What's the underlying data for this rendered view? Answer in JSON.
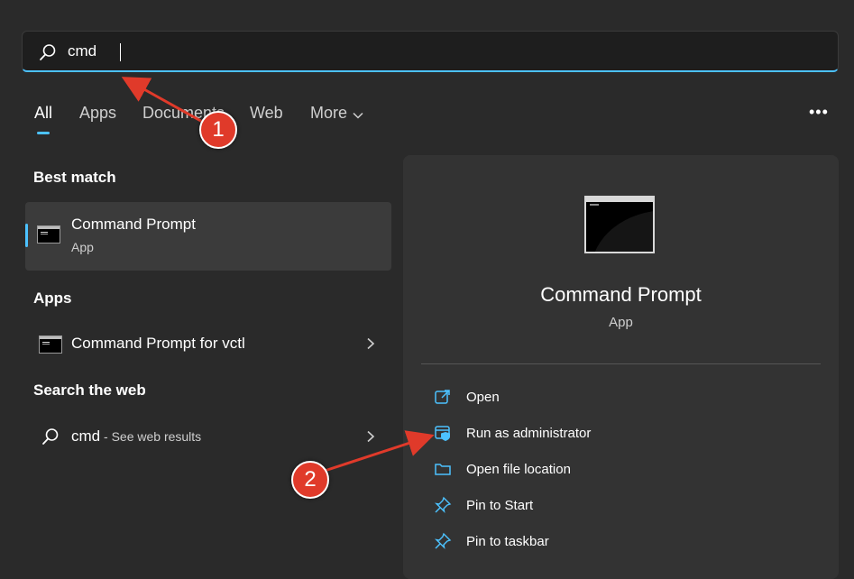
{
  "search": {
    "value": "cmd"
  },
  "tabs": [
    {
      "label": "All"
    },
    {
      "label": "Apps"
    },
    {
      "label": "Documents"
    },
    {
      "label": "Web"
    },
    {
      "label": "More"
    }
  ],
  "best_match": {
    "heading": "Best match",
    "title": "Command Prompt",
    "subtitle": "App"
  },
  "apps": {
    "heading": "Apps",
    "items": [
      {
        "label": "Command Prompt for vctl"
      }
    ]
  },
  "web": {
    "heading": "Search the web",
    "query": "cmd",
    "hint": " - See web results"
  },
  "detail": {
    "title": "Command Prompt",
    "subtitle": "App",
    "actions": [
      {
        "label": "Open",
        "icon": "open-icon"
      },
      {
        "label": "Run as administrator",
        "icon": "run-as-admin-icon"
      },
      {
        "label": "Open file location",
        "icon": "folder-icon"
      },
      {
        "label": "Pin to Start",
        "icon": "pin-icon"
      },
      {
        "label": "Pin to taskbar",
        "icon": "pin-icon"
      }
    ]
  },
  "annotations": [
    {
      "number": "1"
    },
    {
      "number": "2"
    }
  ],
  "colors": {
    "accent": "#4cc2ff",
    "annotation": "#e03a2a",
    "background": "#2a2a2a"
  }
}
